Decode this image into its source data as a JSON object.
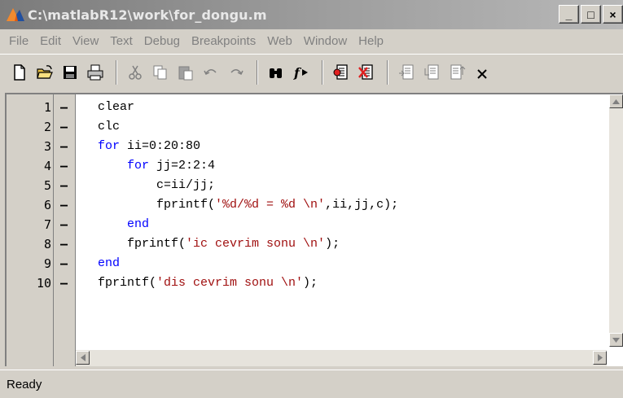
{
  "window": {
    "title": "C:\\matlabR12\\work\\for_dongu.m",
    "minimize": "_",
    "maximize": "□",
    "close": "×"
  },
  "menu": [
    "File",
    "Edit",
    "View",
    "Text",
    "Debug",
    "Breakpoints",
    "Web",
    "Window",
    "Help"
  ],
  "toolbar": [
    "new-file-icon",
    "open-file-icon",
    "save-icon",
    "print-icon",
    "cut-icon",
    "copy-icon",
    "paste-icon",
    "undo-icon",
    "redo-icon",
    "find-icon",
    "function-icon",
    "set-breakpoint-icon",
    "clear-breakpoint-icon",
    "step-icon",
    "step-in-icon",
    "step-out-icon",
    "close-icon"
  ],
  "code": {
    "lines": [
      {
        "num": "1",
        "marker": "–",
        "segments": [
          {
            "t": "clear",
            "c": "plain"
          }
        ]
      },
      {
        "num": "2",
        "marker": "–",
        "segments": [
          {
            "t": "clc",
            "c": "plain"
          }
        ]
      },
      {
        "num": "3",
        "marker": "–",
        "segments": [
          {
            "t": "for",
            "c": "kw"
          },
          {
            "t": " ii=0:20:80",
            "c": "plain"
          }
        ]
      },
      {
        "num": "4",
        "marker": "–",
        "segments": [
          {
            "t": "    ",
            "c": "plain"
          },
          {
            "t": "for",
            "c": "kw"
          },
          {
            "t": " jj=2:2:4",
            "c": "plain"
          }
        ]
      },
      {
        "num": "5",
        "marker": "–",
        "segments": [
          {
            "t": "        c=ii/jj;",
            "c": "plain"
          }
        ]
      },
      {
        "num": "6",
        "marker": "–",
        "segments": [
          {
            "t": "        fprintf(",
            "c": "plain"
          },
          {
            "t": "'%d/%d = %d \\n'",
            "c": "str"
          },
          {
            "t": ",ii,jj,c);",
            "c": "plain"
          }
        ]
      },
      {
        "num": "7",
        "marker": "–",
        "segments": [
          {
            "t": "    ",
            "c": "plain"
          },
          {
            "t": "end",
            "c": "kw"
          }
        ]
      },
      {
        "num": "8",
        "marker": "–",
        "segments": [
          {
            "t": "    fprintf(",
            "c": "plain"
          },
          {
            "t": "'ic cevrim sonu \\n'",
            "c": "str"
          },
          {
            "t": ");",
            "c": "plain"
          }
        ]
      },
      {
        "num": "9",
        "marker": "–",
        "segments": [
          {
            "t": "end",
            "c": "kw"
          }
        ]
      },
      {
        "num": "10",
        "marker": "–",
        "segments": [
          {
            "t": "fprintf(",
            "c": "plain"
          },
          {
            "t": "'dis cevrim sonu \\n'",
            "c": "str"
          },
          {
            "t": ");",
            "c": "plain"
          }
        ]
      }
    ]
  },
  "status": {
    "text": "Ready"
  },
  "colors": {
    "keyword": "#0000ff",
    "string": "#a01010",
    "chrome": "#d4d0c8"
  }
}
